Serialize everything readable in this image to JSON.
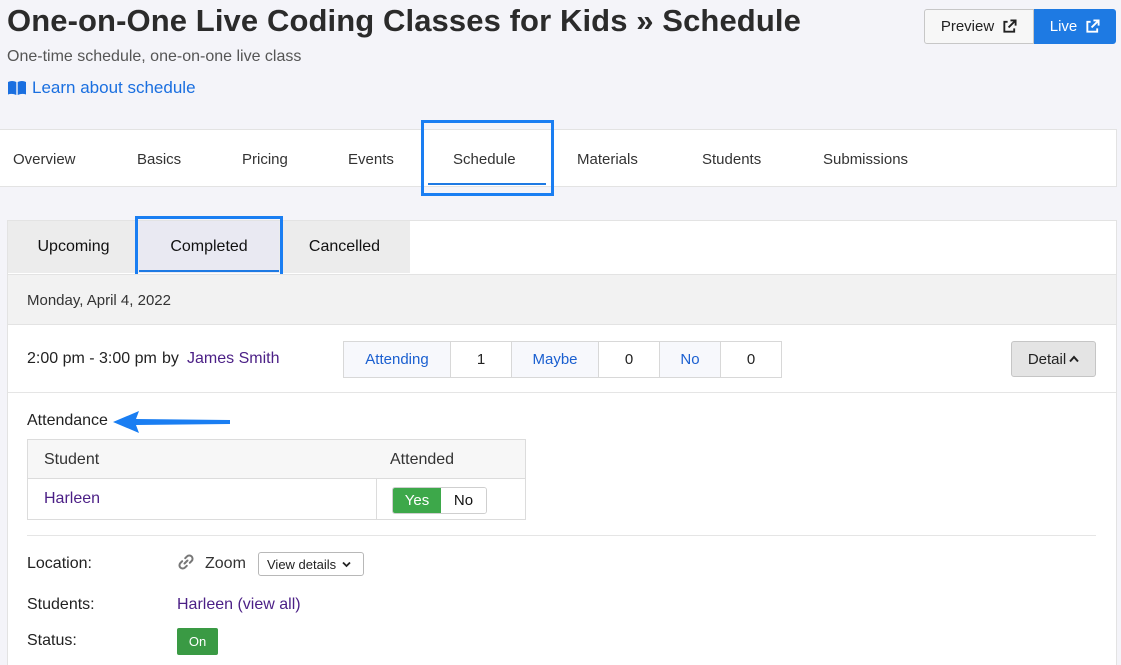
{
  "header": {
    "title": "One-on-One Live Coding Classes for Kids » Schedule",
    "subtitle": "One-time schedule, one-on-one live class",
    "learn_link": "Learn about schedule",
    "preview_label": "Preview",
    "live_label": "Live"
  },
  "main_tabs": [
    "Overview",
    "Basics",
    "Pricing",
    "Events",
    "Schedule",
    "Materials",
    "Students",
    "Submissions"
  ],
  "sub_tabs": [
    "Upcoming",
    "Completed",
    "Cancelled"
  ],
  "session": {
    "date": "Monday, April 4, 2022",
    "time": "2:00 pm - 3:00 pm",
    "by": "by",
    "teacher": "James Smith",
    "rsvp": {
      "attending_label": "Attending",
      "attending_count": "1",
      "maybe_label": "Maybe",
      "maybe_count": "0",
      "no_label": "No",
      "no_count": "0"
    },
    "detail_label": "Detail"
  },
  "attendance": {
    "label": "Attendance",
    "col_student": "Student",
    "col_attended": "Attended",
    "rows": [
      {
        "student": "Harleen",
        "yes": "Yes",
        "no": "No"
      }
    ]
  },
  "info": {
    "location_label": "Location:",
    "location_value": "Zoom",
    "view_details": "View details",
    "students_label": "Students:",
    "students_value": "Harleen (view all)",
    "status_label": "Status:",
    "status_value": "On"
  },
  "colors": {
    "accent_blue": "#1e7ae3",
    "highlight_blue": "#1a7ef2",
    "success_green": "#3da84a",
    "link_purple": "#4b1f86"
  }
}
